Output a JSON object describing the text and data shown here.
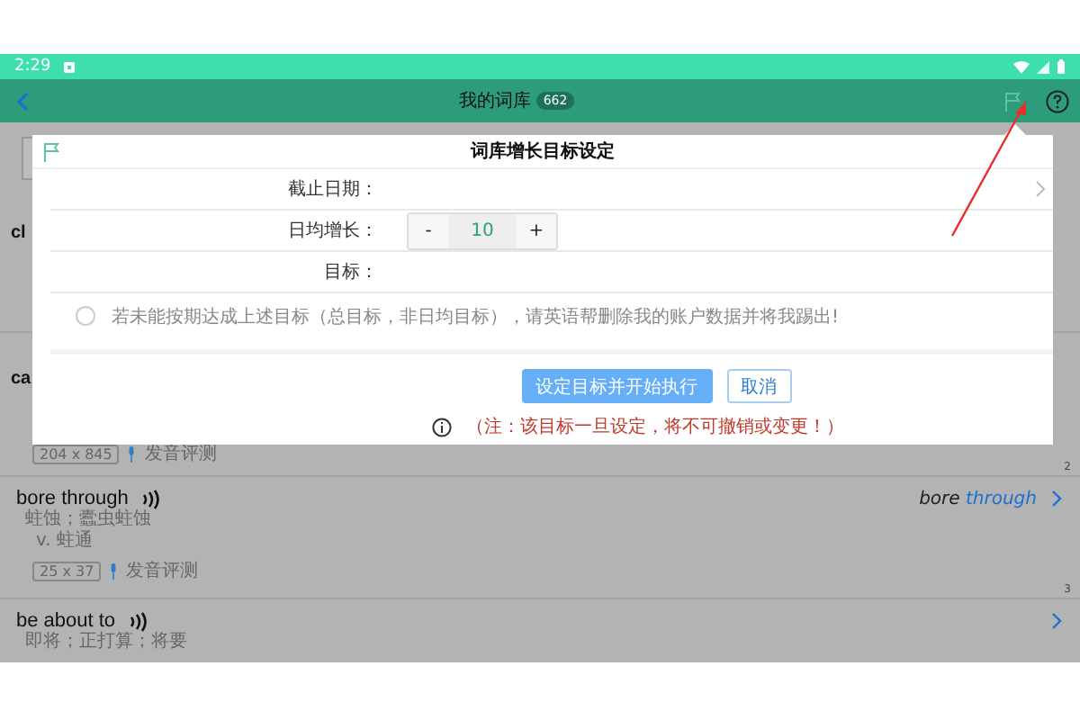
{
  "status_bar": {
    "time": "2:29"
  },
  "app_bar": {
    "title": "我的词库",
    "count": "662"
  },
  "words": [
    {
      "word": "cl"
    },
    {
      "word": "ca",
      "size": "204 x 845",
      "eval": "发音评测",
      "index": "2"
    },
    {
      "word": "bore through",
      "meanings": [
        "蛀蚀；蠹虫蛀蚀",
        "v.  蛀通"
      ],
      "example_plain": "bore",
      "example_highlight": "through",
      "size": "25 x 37",
      "eval": "发音评测",
      "index": "3"
    },
    {
      "word": "be about to",
      "meanings": [
        "即将；正打算；将要"
      ]
    }
  ],
  "dialog": {
    "title": "词库增长目标设定",
    "fields": [
      {
        "kind": "picker",
        "label": "截止日期："
      },
      {
        "kind": "stepper",
        "label": "日均增长：",
        "value": "10",
        "minus": "-",
        "plus": "+"
      },
      {
        "kind": "text",
        "label": "目标："
      }
    ],
    "pledge": {
      "checked": false,
      "text": "若未能按期达成上述目标（总目标，非日均目标），请英语帮删除我的账户数据并将我踢出!"
    },
    "buttons": [
      {
        "label": "设定目标并开始执行",
        "kind": "primary"
      },
      {
        "label": "取消",
        "kind": "secondary"
      }
    ],
    "note": "（注：该目标一旦设定，将不可撤销或变更！）"
  }
}
